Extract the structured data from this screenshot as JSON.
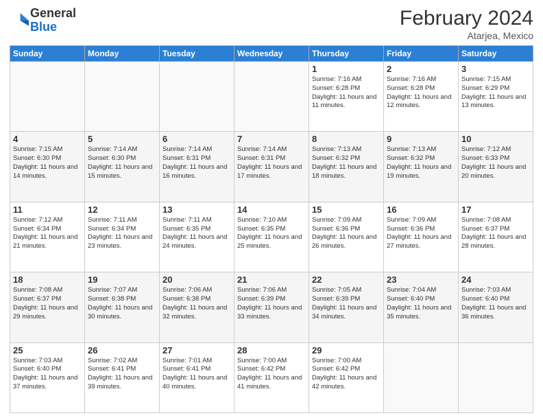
{
  "logo": {
    "general": "General",
    "blue": "Blue"
  },
  "header": {
    "month": "February 2024",
    "location": "Atarjea, Mexico"
  },
  "weekdays": [
    "Sunday",
    "Monday",
    "Tuesday",
    "Wednesday",
    "Thursday",
    "Friday",
    "Saturday"
  ],
  "weeks": [
    [
      {
        "day": "",
        "info": ""
      },
      {
        "day": "",
        "info": ""
      },
      {
        "day": "",
        "info": ""
      },
      {
        "day": "",
        "info": ""
      },
      {
        "day": "1",
        "info": "Sunrise: 7:16 AM\nSunset: 6:28 PM\nDaylight: 11 hours and 11 minutes."
      },
      {
        "day": "2",
        "info": "Sunrise: 7:16 AM\nSunset: 6:28 PM\nDaylight: 11 hours and 12 minutes."
      },
      {
        "day": "3",
        "info": "Sunrise: 7:15 AM\nSunset: 6:29 PM\nDaylight: 11 hours and 13 minutes."
      }
    ],
    [
      {
        "day": "4",
        "info": "Sunrise: 7:15 AM\nSunset: 6:30 PM\nDaylight: 11 hours and 14 minutes."
      },
      {
        "day": "5",
        "info": "Sunrise: 7:14 AM\nSunset: 6:30 PM\nDaylight: 11 hours and 15 minutes."
      },
      {
        "day": "6",
        "info": "Sunrise: 7:14 AM\nSunset: 6:31 PM\nDaylight: 11 hours and 16 minutes."
      },
      {
        "day": "7",
        "info": "Sunrise: 7:14 AM\nSunset: 6:31 PM\nDaylight: 11 hours and 17 minutes."
      },
      {
        "day": "8",
        "info": "Sunrise: 7:13 AM\nSunset: 6:32 PM\nDaylight: 11 hours and 18 minutes."
      },
      {
        "day": "9",
        "info": "Sunrise: 7:13 AM\nSunset: 6:32 PM\nDaylight: 11 hours and 19 minutes."
      },
      {
        "day": "10",
        "info": "Sunrise: 7:12 AM\nSunset: 6:33 PM\nDaylight: 11 hours and 20 minutes."
      }
    ],
    [
      {
        "day": "11",
        "info": "Sunrise: 7:12 AM\nSunset: 6:34 PM\nDaylight: 11 hours and 21 minutes."
      },
      {
        "day": "12",
        "info": "Sunrise: 7:11 AM\nSunset: 6:34 PM\nDaylight: 11 hours and 23 minutes."
      },
      {
        "day": "13",
        "info": "Sunrise: 7:11 AM\nSunset: 6:35 PM\nDaylight: 11 hours and 24 minutes."
      },
      {
        "day": "14",
        "info": "Sunrise: 7:10 AM\nSunset: 6:35 PM\nDaylight: 11 hours and 25 minutes."
      },
      {
        "day": "15",
        "info": "Sunrise: 7:09 AM\nSunset: 6:36 PM\nDaylight: 11 hours and 26 minutes."
      },
      {
        "day": "16",
        "info": "Sunrise: 7:09 AM\nSunset: 6:36 PM\nDaylight: 11 hours and 27 minutes."
      },
      {
        "day": "17",
        "info": "Sunrise: 7:08 AM\nSunset: 6:37 PM\nDaylight: 11 hours and 28 minutes."
      }
    ],
    [
      {
        "day": "18",
        "info": "Sunrise: 7:08 AM\nSunset: 6:37 PM\nDaylight: 11 hours and 29 minutes."
      },
      {
        "day": "19",
        "info": "Sunrise: 7:07 AM\nSunset: 6:38 PM\nDaylight: 11 hours and 30 minutes."
      },
      {
        "day": "20",
        "info": "Sunrise: 7:06 AM\nSunset: 6:38 PM\nDaylight: 11 hours and 32 minutes."
      },
      {
        "day": "21",
        "info": "Sunrise: 7:06 AM\nSunset: 6:39 PM\nDaylight: 11 hours and 33 minutes."
      },
      {
        "day": "22",
        "info": "Sunrise: 7:05 AM\nSunset: 6:39 PM\nDaylight: 11 hours and 34 minutes."
      },
      {
        "day": "23",
        "info": "Sunrise: 7:04 AM\nSunset: 6:40 PM\nDaylight: 11 hours and 35 minutes."
      },
      {
        "day": "24",
        "info": "Sunrise: 7:03 AM\nSunset: 6:40 PM\nDaylight: 11 hours and 36 minutes."
      }
    ],
    [
      {
        "day": "25",
        "info": "Sunrise: 7:03 AM\nSunset: 6:40 PM\nDaylight: 11 hours and 37 minutes."
      },
      {
        "day": "26",
        "info": "Sunrise: 7:02 AM\nSunset: 6:41 PM\nDaylight: 11 hours and 39 minutes."
      },
      {
        "day": "27",
        "info": "Sunrise: 7:01 AM\nSunset: 6:41 PM\nDaylight: 11 hours and 40 minutes."
      },
      {
        "day": "28",
        "info": "Sunrise: 7:00 AM\nSunset: 6:42 PM\nDaylight: 11 hours and 41 minutes."
      },
      {
        "day": "29",
        "info": "Sunrise: 7:00 AM\nSunset: 6:42 PM\nDaylight: 11 hours and 42 minutes."
      },
      {
        "day": "",
        "info": ""
      },
      {
        "day": "",
        "info": ""
      }
    ]
  ]
}
